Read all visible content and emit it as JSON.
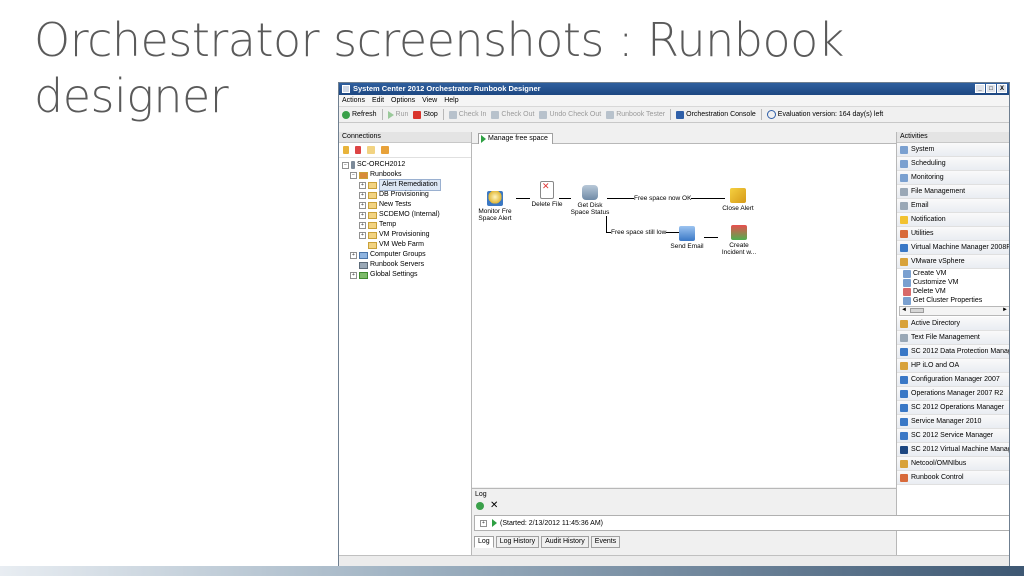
{
  "slide": {
    "title_line1": "Orchestrator screenshots : Runbook",
    "title_line2": "designer"
  },
  "window": {
    "title": "System Center 2012 Orchestrator Runbook Designer",
    "controls": [
      "_",
      "□",
      "X"
    ]
  },
  "menu": [
    "Actions",
    "Edit",
    "Options",
    "View",
    "Help"
  ],
  "toolbar": {
    "refresh": "Refresh",
    "run": "Run",
    "stop": "Stop",
    "check_in": "Check In",
    "check_out": "Check Out",
    "undo_check_out": "Undo Check Out",
    "runbook_tester": "Runbook Tester",
    "orchestration_console": "Orchestration Console",
    "evaluation": "Evaluation version: 164 day(s) left"
  },
  "connections": {
    "header": "Connections",
    "root": "SC-ORCH2012",
    "runbooks": "Runbooks",
    "folders": [
      "Alert Remediation",
      "DB Provisioning",
      "New Tests",
      "SCDEMO (Internal)",
      "Temp",
      "VM Provisioning",
      "VM Web Farm"
    ],
    "computer_groups": "Computer Groups",
    "runbook_servers": "Runbook Servers",
    "global_settings": "Global Settings"
  },
  "canvas": {
    "tab": "Manage free space",
    "activities": {
      "monitor": "Monitor Fre Space Alert",
      "delete": "Delete File",
      "get_disk": "Get Disk Space Status",
      "close": "Close Alert",
      "send_email": "Send Email",
      "create_incident": "Create Incident w..."
    },
    "links": {
      "ok": "Free space now OK",
      "low": "Free space still low"
    }
  },
  "activities_pane": {
    "header": "Activities",
    "top": [
      "System",
      "Scheduling",
      "Monitoring",
      "File Management",
      "Email",
      "Notification",
      "Utilities",
      "Virtual Machine Manager 2008R",
      "VMware vSphere"
    ],
    "vmware_items": [
      "Create VM",
      "Customize VM",
      "Delete VM",
      "Get Cluster Properties"
    ],
    "bottom": [
      "Active Directory",
      "Text File Management",
      "SC 2012 Data Protection Manag",
      "HP iLO and OA",
      "Configuration Manager 2007",
      "Operations Manager 2007 R2",
      "SC 2012 Operations Manager",
      "Service Manager 2010",
      "SC 2012 Service Manager",
      "SC 2012 Virtual Machine Manag",
      "Netcool/OMNIbus",
      "Runbook Control"
    ]
  },
  "log": {
    "header": "Log",
    "entry": "(Started: 2/13/2012 11:45:36 AM)",
    "tabs": [
      "Log",
      "Log History",
      "Audit History",
      "Events"
    ]
  },
  "colors": {
    "title_bar": "#1d4781",
    "slide_title": "#5a5a5a",
    "run_green": "#2ea043",
    "stop_red": "#d9342b"
  }
}
